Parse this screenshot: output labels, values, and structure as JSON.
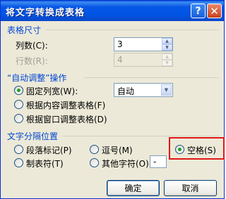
{
  "window": {
    "title": "将文字转换成表格",
    "help_label": "?",
    "close_label": "✕"
  },
  "table_size": {
    "section_title": "表格尺寸",
    "columns_label": "列数(C):",
    "columns_value": "3",
    "rows_label": "行数(R):",
    "rows_value": "4"
  },
  "autofit": {
    "section_title": "“自动调整”操作",
    "fixed_width_label": "固定列宽(W):",
    "fixed_width_value": "自动",
    "content_label": "根据内容调整表格(F)",
    "window_label": "根据窗口调整表格(D)",
    "selected": "fixed_width"
  },
  "separator": {
    "section_title": "文字分隔位置",
    "paragraph_label": "段落标记(P)",
    "comma_label": "逗号(M)",
    "space_label": "空格(S)",
    "tab_label": "制表符(T)",
    "other_label": "其他字符(O):",
    "other_value": "-",
    "selected": "space"
  },
  "buttons": {
    "ok_label": "确定",
    "cancel_label": "取消"
  },
  "colors": {
    "title_bar": "#0054e3",
    "section_title": "#0046d5",
    "highlight": "#e01818",
    "radio_selected": "#21a121"
  }
}
